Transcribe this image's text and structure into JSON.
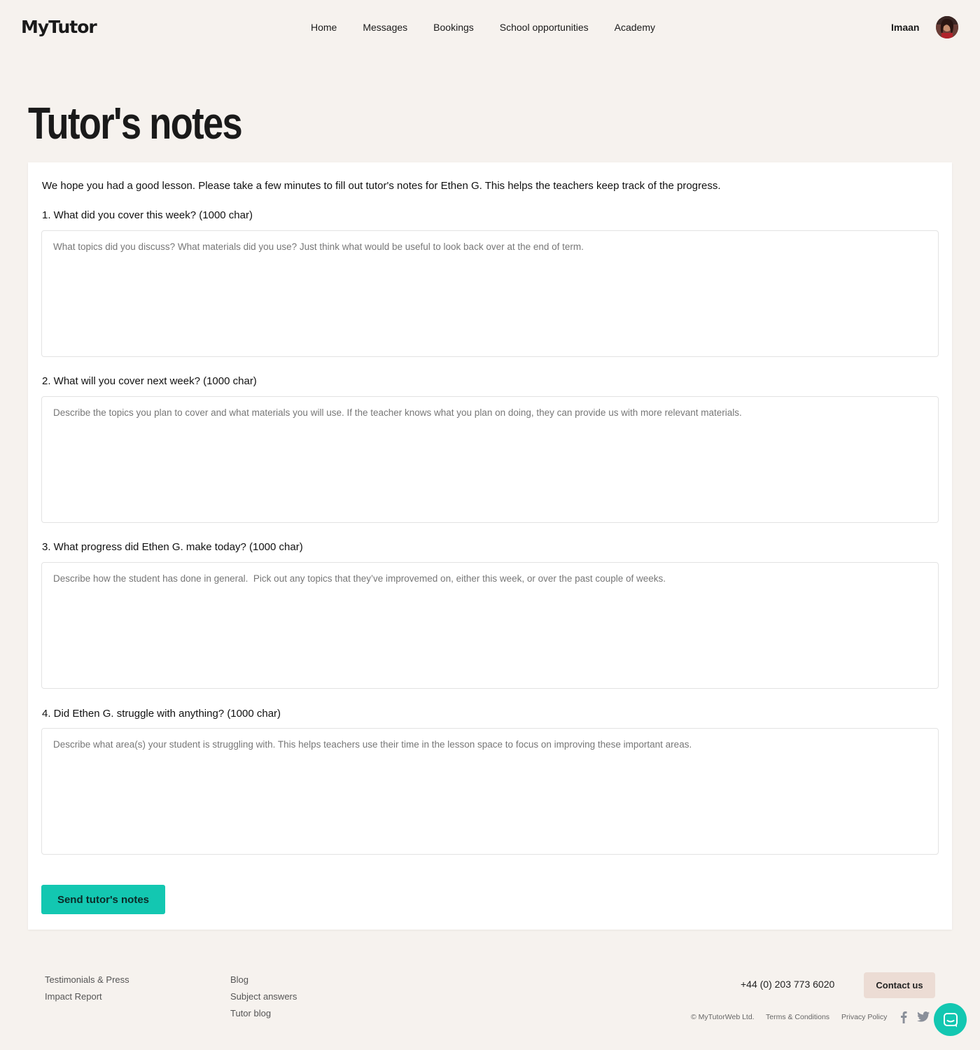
{
  "header": {
    "logo": "MyTutor",
    "nav": [
      "Home",
      "Messages",
      "Bookings",
      "School opportunities",
      "Academy"
    ],
    "user_name": "Imaan"
  },
  "page": {
    "title": "Tutor's notes",
    "intro": "We hope you had a good lesson. Please take a few minutes to fill out tutor's notes for Ethen G. This helps the teachers keep track of the progress."
  },
  "questions": [
    {
      "label": "1. What did you cover this week? (1000 char)",
      "placeholder": "What topics did you discuss? What materials did you use? Just think what would be useful to look back over at the end of term."
    },
    {
      "label": "2. What will you cover next week? (1000 char)",
      "placeholder": "Describe the topics you plan to cover and what materials you will use. If the teacher knows what you plan on doing, they can provide us with more relevant materials."
    },
    {
      "label": "3. What progress did Ethen G. make today? (1000 char)",
      "placeholder": "Describe how the student has done in general.  Pick out any topics that they’ve improvemed on, either this week, or over the past couple of weeks."
    },
    {
      "label": "4. Did Ethen G. struggle with anything? (1000 char)",
      "placeholder": "Describe what area(s) your student is struggling with. This helps teachers use their time in the lesson space to focus on improving these important areas."
    }
  ],
  "submit_label": "Send tutor's notes",
  "footer": {
    "col1": [
      "Testimonials & Press",
      "Impact Report"
    ],
    "col2": [
      "Blog",
      "Subject answers",
      "Tutor blog"
    ],
    "phone": "+44 (0) 203 773 6020",
    "contact_label": "Contact us",
    "copyright": "© MyTutorWeb Ltd.",
    "terms": "Terms & Conditions",
    "privacy": "Privacy Policy"
  },
  "colors": {
    "accent": "#13c7b1",
    "background": "#f6f2ee",
    "contact_button": "#ecdcd4"
  },
  "icons": [
    "facebook-icon",
    "twitter-icon",
    "chat-icon",
    "avatar"
  ]
}
